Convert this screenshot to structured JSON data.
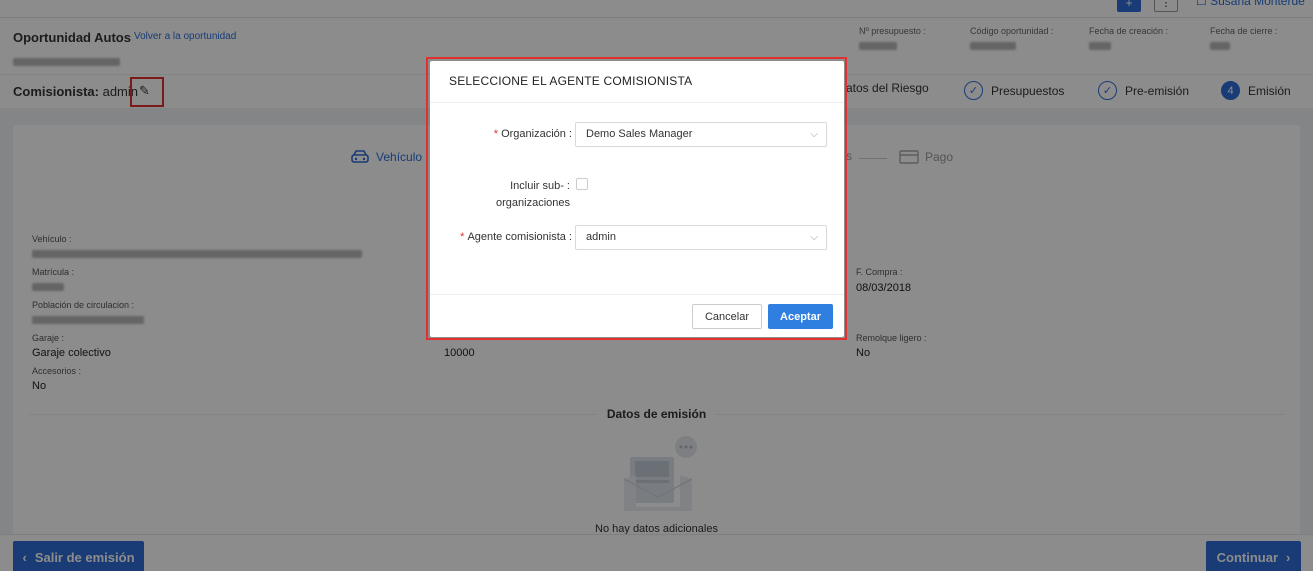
{
  "topbar": {
    "plus_label": "+",
    "more_label": "⋮",
    "user_name": "Susana Monterde"
  },
  "header": {
    "title": "Oportunidad Autos",
    "back_link": "Volver a la oportunidad",
    "meta": [
      {
        "label": "Nº presupuesto :"
      },
      {
        "label": "Código oportunidad :"
      },
      {
        "label": "Fecha de creación :"
      },
      {
        "label": "Fecha de cierre :"
      }
    ]
  },
  "subheader": {
    "comisionista_label": "Comisionista:",
    "comisionista_value": "admin",
    "edit_icon": "pencil-icon",
    "steps": [
      {
        "label": "atos del Riesgo",
        "state": "partial"
      },
      {
        "label": "Presupuestos",
        "state": "done",
        "icon": "✓"
      },
      {
        "label": "Pre-emisión",
        "state": "done",
        "icon": "✓"
      },
      {
        "label": "Emisión",
        "state": "current",
        "icon": "4"
      }
    ]
  },
  "content": {
    "tab_vehicle": "Vehículo",
    "tab_payment": "Pago",
    "tab_partial": "s",
    "fields": {
      "vehiculo_label": "Vehículo :",
      "matricula_label": "Matrícula :",
      "poblacion_label": "Población de circulacion :",
      "garaje_label": "Garaje :",
      "garaje_value": "Garaje colectivo",
      "accesorios_label": "Accesorios :",
      "accesorios_value": "No",
      "km_value": "10000",
      "fcompra_label": "F. Compra :",
      "fcompra_value": "08/03/2018",
      "remolque_label": "Remolque ligero :",
      "remolque_value": "No"
    },
    "section_title": "Datos de emisión",
    "empty_text": "No hay datos adicionales"
  },
  "footer": {
    "exit_label": "Salir de emisión",
    "next_label": "Continuar"
  },
  "modal": {
    "title": "SELECCIONE EL AGENTE COMISIONISTA",
    "org_label": "Organización :",
    "org_value": "Demo Sales Manager",
    "sub_label_line1": "Incluir sub- :",
    "sub_label_line2": "organizaciones",
    "agent_label": "Agente comisionista :",
    "agent_value": "admin",
    "cancel_label": "Cancelar",
    "accept_label": "Aceptar"
  },
  "colors": {
    "accent": "#2f6ed8",
    "highlight": "#e0302f"
  }
}
